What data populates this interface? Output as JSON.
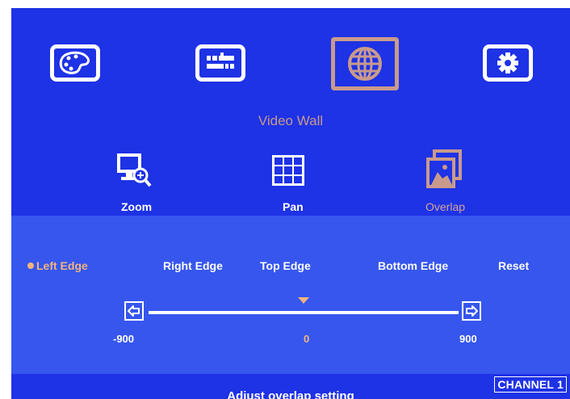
{
  "menu": {
    "title": "Video Wall",
    "icons": [
      "palette-icon",
      "sliders-icon",
      "globe-icon",
      "gear-icon"
    ],
    "selected_index": 2
  },
  "submenu": {
    "items": [
      {
        "label": "Zoom",
        "icon": "monitor-zoom-icon"
      },
      {
        "label": "Pan",
        "icon": "grid-pan-icon"
      },
      {
        "label": "Overlap",
        "icon": "overlap-pictures-icon"
      }
    ],
    "selected_index": 2
  },
  "options": {
    "items": [
      "Left Edge",
      "Right Edge",
      "Top Edge",
      "Bottom Edge",
      "Reset"
    ],
    "selected_index": 0
  },
  "slider": {
    "min_label": "-900",
    "max_label": "900",
    "value_label": "0",
    "min": -900,
    "max": 900,
    "value": 0
  },
  "status": {
    "channel": "CHANNEL 1",
    "help_text": "Adjust overlap setting"
  },
  "colors": {
    "background": "#1e32e6",
    "panel": "#3656ee",
    "highlight": "#f2b480",
    "selected_frame": "#c99a8c"
  }
}
